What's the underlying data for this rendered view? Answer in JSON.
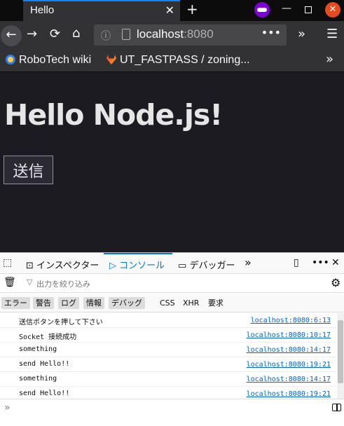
{
  "browser": {
    "tab_title": "Hello",
    "tab_close": "✕",
    "new_tab": "+",
    "url_host": "localhost",
    "url_port": ":8080",
    "url_dots": "•••",
    "overflow": "»",
    "menu": "☰",
    "window_min": "—",
    "window_close": "✕"
  },
  "bookmarks": [
    {
      "label": "RoboTech wiki"
    },
    {
      "label": "UT_FASTPASS / zoning..."
    }
  ],
  "page": {
    "heading": "Hello Node.js!",
    "send_button": "送信"
  },
  "devtools": {
    "tabs": {
      "inspector": "インスペクター",
      "console": "コンソール",
      "debugger": "デバッガー"
    },
    "filter_placeholder": "出力を絞り込み",
    "levels": [
      "エラー",
      "警告",
      "ログ",
      "情報",
      "デバッグ"
    ],
    "types": [
      "CSS",
      "XHR",
      "要求"
    ],
    "logs": [
      {
        "message": "送信ボタンを押して下さい",
        "source": "localhost:8080:6:13"
      },
      {
        "message": "Socket 接続成功",
        "source": "localhost:8080:10:17"
      },
      {
        "message": "something",
        "source": "localhost:8080:14:17"
      },
      {
        "message": "send Hello!!",
        "source": "localhost:8080:19:21"
      },
      {
        "message": "something",
        "source": "localhost:8080:14:17"
      },
      {
        "message": "send Hello!!",
        "source": "localhost:8080:19:21"
      }
    ],
    "prompt": "»"
  }
}
